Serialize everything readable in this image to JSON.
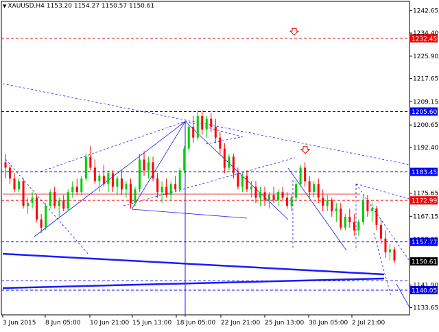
{
  "header": {
    "symbol": "XAUUSD,H4",
    "ohlc": "1153.20 1154.27 1150.57 1150.61"
  },
  "chart_data": {
    "type": "candlestick",
    "symbol": "XAUUSD,H4",
    "timeframe": "H4",
    "ohlc_current": {
      "open": 1153.2,
      "high": 1154.27,
      "low": 1150.57,
      "close": 1150.61
    },
    "ylim": [
      1131.0,
      1246.0
    ],
    "y_ticks": [
      "1242.65",
      "1234.40",
      "1225.90",
      "1217.65",
      "1209.15",
      "1200.65",
      "1192.40",
      "1175.65",
      "1167.15",
      "1158.65",
      "1141.90",
      "1133.65"
    ],
    "x_ticks": [
      "3 Jun 2015",
      "8 Jun 05:00",
      "10 Jun 21:00",
      "15 Jun 13:00",
      "18 Jun 05:00",
      "22 Jun 21:00",
      "25 Jun 13:00",
      "30 Jun 05:00",
      "2 Jul 21:00"
    ],
    "level_labels": [
      {
        "text": "1232.45",
        "value": 1232.45,
        "color": "#ff0000"
      },
      {
        "text": "1205.60",
        "value": 1205.6,
        "color": "#0000ff"
      },
      {
        "text": "1183.45",
        "value": 1183.45,
        "color": "#0000ff"
      },
      {
        "text": "1172.99",
        "value": 1172.99,
        "color": "#ff0000"
      },
      {
        "text": "1157.77",
        "value": 1157.77,
        "color": "#0000ff"
      },
      {
        "text": "1150.61",
        "value": 1150.61,
        "color": "#000000"
      },
      {
        "text": "1140.05",
        "value": 1140.05,
        "color": "#0000ff"
      }
    ],
    "candles": [
      [
        1187,
        1190,
        1181,
        1185
      ],
      [
        1185,
        1186,
        1179,
        1181
      ],
      [
        1181,
        1183,
        1176,
        1177
      ],
      [
        1177,
        1181,
        1176,
        1180
      ],
      [
        1180,
        1181,
        1170,
        1171
      ],
      [
        1171,
        1174,
        1168,
        1172
      ],
      [
        1172,
        1176,
        1170,
        1174
      ],
      [
        1174,
        1175,
        1165,
        1166
      ],
      [
        1166,
        1168,
        1161,
        1163
      ],
      [
        1163,
        1172,
        1162,
        1171
      ],
      [
        1171,
        1177,
        1170,
        1176
      ],
      [
        1176,
        1178,
        1170,
        1171
      ],
      [
        1171,
        1174,
        1167,
        1173
      ],
      [
        1173,
        1175,
        1169,
        1170
      ],
      [
        1170,
        1177,
        1169,
        1176
      ],
      [
        1176,
        1180,
        1174,
        1178
      ],
      [
        1178,
        1181,
        1175,
        1176
      ],
      [
        1176,
        1182,
        1175,
        1181
      ],
      [
        1181,
        1190,
        1180,
        1189
      ],
      [
        1189,
        1193,
        1184,
        1185
      ],
      [
        1185,
        1188,
        1179,
        1180
      ],
      [
        1180,
        1183,
        1176,
        1182
      ],
      [
        1182,
        1186,
        1178,
        1179
      ],
      [
        1179,
        1184,
        1176,
        1183
      ],
      [
        1183,
        1184,
        1176,
        1178
      ],
      [
        1178,
        1182,
        1175,
        1181
      ],
      [
        1181,
        1184,
        1175,
        1177
      ],
      [
        1177,
        1180,
        1174,
        1179
      ],
      [
        1179,
        1181,
        1170,
        1172
      ],
      [
        1172,
        1178,
        1171,
        1177
      ],
      [
        1177,
        1190,
        1176,
        1188
      ],
      [
        1188,
        1191,
        1182,
        1184
      ],
      [
        1184,
        1189,
        1181,
        1187
      ],
      [
        1187,
        1189,
        1180,
        1181
      ],
      [
        1181,
        1183,
        1174,
        1176
      ],
      [
        1176,
        1180,
        1172,
        1178
      ],
      [
        1178,
        1181,
        1174,
        1175
      ],
      [
        1175,
        1180,
        1173,
        1179
      ],
      [
        1179,
        1182,
        1176,
        1177
      ],
      [
        1177,
        1185,
        1176,
        1184
      ],
      [
        1184,
        1193,
        1183,
        1192
      ],
      [
        1192,
        1201,
        1191,
        1200
      ],
      [
        1200,
        1204,
        1194,
        1196
      ],
      [
        1196,
        1206,
        1195,
        1204
      ],
      [
        1204,
        1206,
        1197,
        1199
      ],
      [
        1199,
        1204,
        1196,
        1203
      ],
      [
        1203,
        1205,
        1198,
        1200
      ],
      [
        1200,
        1203,
        1194,
        1196
      ],
      [
        1196,
        1198,
        1190,
        1192
      ],
      [
        1192,
        1194,
        1183,
        1185
      ],
      [
        1185,
        1190,
        1184,
        1189
      ],
      [
        1189,
        1190,
        1181,
        1183
      ],
      [
        1183,
        1185,
        1177,
        1178
      ],
      [
        1178,
        1183,
        1176,
        1182
      ],
      [
        1182,
        1184,
        1176,
        1177
      ],
      [
        1177,
        1180,
        1174,
        1178
      ],
      [
        1178,
        1180,
        1172,
        1174
      ],
      [
        1174,
        1178,
        1171,
        1176
      ],
      [
        1176,
        1178,
        1171,
        1173
      ],
      [
        1173,
        1176,
        1170,
        1175
      ],
      [
        1175,
        1178,
        1172,
        1173
      ],
      [
        1173,
        1177,
        1171,
        1176
      ],
      [
        1176,
        1178,
        1173,
        1174
      ],
      [
        1174,
        1176,
        1170,
        1171
      ],
      [
        1171,
        1175,
        1169,
        1174
      ],
      [
        1174,
        1180,
        1173,
        1179
      ],
      [
        1179,
        1186,
        1178,
        1185
      ],
      [
        1185,
        1187,
        1178,
        1180
      ],
      [
        1180,
        1182,
        1174,
        1176
      ],
      [
        1176,
        1180,
        1174,
        1179
      ],
      [
        1179,
        1181,
        1172,
        1174
      ],
      [
        1174,
        1177,
        1169,
        1171
      ],
      [
        1171,
        1175,
        1169,
        1173
      ],
      [
        1173,
        1174,
        1167,
        1169
      ],
      [
        1169,
        1172,
        1165,
        1170
      ],
      [
        1170,
        1172,
        1162,
        1163
      ],
      [
        1163,
        1168,
        1162,
        1167
      ],
      [
        1167,
        1170,
        1163,
        1165
      ],
      [
        1165,
        1168,
        1160,
        1162
      ],
      [
        1162,
        1166,
        1160,
        1165
      ],
      [
        1165,
        1175,
        1164,
        1173
      ],
      [
        1173,
        1175,
        1167,
        1169
      ],
      [
        1169,
        1172,
        1165,
        1170
      ],
      [
        1170,
        1171,
        1162,
        1164
      ],
      [
        1164,
        1166,
        1157,
        1159
      ],
      [
        1159,
        1162,
        1152,
        1154
      ],
      [
        1154,
        1157,
        1151,
        1155
      ],
      [
        1155,
        1156,
        1150,
        1151
      ]
    ]
  }
}
